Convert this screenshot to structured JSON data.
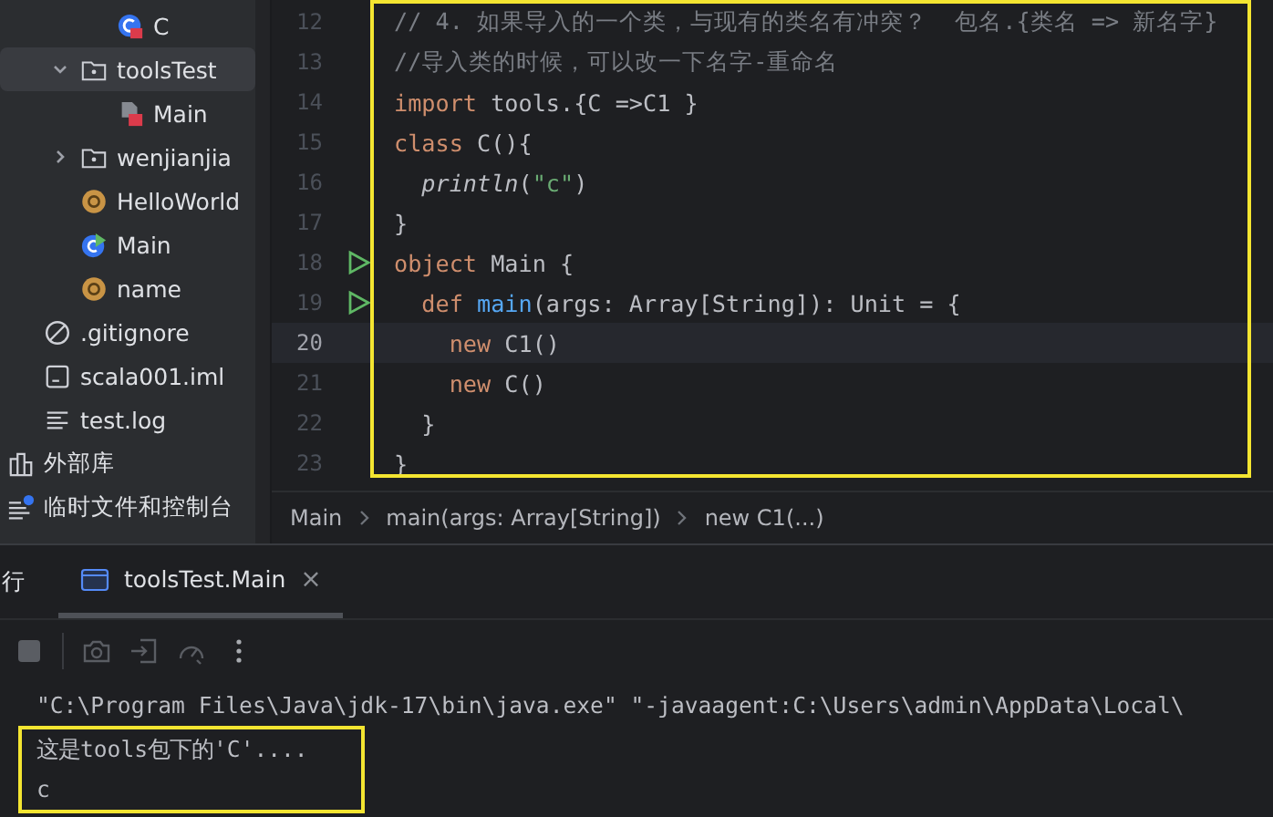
{
  "project_tree": [
    {
      "children": [
        {
          "children": [
            {
              "children": [
                {
                  "label": "C",
                  "kind": "class",
                  "selected": false
                }
              ]
            },
            {
              "label": "toolsTest",
              "kind": "package",
              "expanded": true,
              "selected": true,
              "children": [
                {
                  "label": "Main",
                  "kind": "file",
                  "selected": false
                }
              ]
            },
            {
              "label": "wenjianjia",
              "kind": "package",
              "expanded": false,
              "selected": false
            },
            {
              "label": "HelloWorld",
              "kind": "object",
              "selected": false
            },
            {
              "label": "Main",
              "kind": "runnable",
              "selected": false
            },
            {
              "label": "name",
              "kind": "object",
              "selected": false
            }
          ]
        },
        {
          "label": ".gitignore",
          "kind": "ignore",
          "selected": false
        },
        {
          "label": "scala001.iml",
          "kind": "module",
          "selected": false
        },
        {
          "label": "test.log",
          "kind": "text",
          "selected": false
        }
      ]
    },
    {
      "label": "外部库",
      "kind": "library",
      "selected": false
    },
    {
      "label": "临时文件和控制台",
      "kind": "scratches",
      "selected": false
    }
  ],
  "editor": {
    "highlighted": true,
    "lines": [
      {
        "number": "12",
        "run": false,
        "current": false,
        "tokens": [
          {
            "kind": "comment",
            "text": "// 4. 如果导入的一个类，与现有的类名有冲突？  包名.{类名 => 新名字}"
          }
        ]
      },
      {
        "number": "13",
        "run": false,
        "current": false,
        "tokens": [
          {
            "kind": "comment",
            "text": "//导入类的时候，可以改一下名字-重命名"
          }
        ]
      },
      {
        "number": "14",
        "run": false,
        "current": false,
        "tokens": [
          {
            "kind": "keyword",
            "text": "import"
          },
          {
            "kind": "plain",
            "text": " tools.{C =>C1 }"
          }
        ]
      },
      {
        "number": "15",
        "run": false,
        "current": false,
        "tokens": [
          {
            "kind": "keyword",
            "text": "class"
          },
          {
            "kind": "plain",
            "text": " C(){"
          }
        ]
      },
      {
        "number": "16",
        "run": false,
        "current": false,
        "tokens": [
          {
            "kind": "italic",
            "text": "  println"
          },
          {
            "kind": "plain",
            "text": "("
          },
          {
            "kind": "string",
            "text": "\"c\""
          },
          {
            "kind": "plain",
            "text": ")"
          }
        ]
      },
      {
        "number": "17",
        "run": false,
        "current": false,
        "tokens": [
          {
            "kind": "plain",
            "text": "}"
          }
        ]
      },
      {
        "number": "18",
        "run": true,
        "current": false,
        "tokens": [
          {
            "kind": "keyword",
            "text": "object"
          },
          {
            "kind": "plain",
            "text": " Main {"
          }
        ]
      },
      {
        "number": "19",
        "run": true,
        "current": false,
        "tokens": [
          {
            "kind": "keyword",
            "text": "  def"
          },
          {
            "kind": "function",
            "text": " main"
          },
          {
            "kind": "plain",
            "text": "(args: Array[String]): Unit = {"
          }
        ]
      },
      {
        "number": "20",
        "run": false,
        "current": true,
        "tokens": [
          {
            "kind": "keyword",
            "text": "    new"
          },
          {
            "kind": "plain",
            "text": " C1()"
          }
        ]
      },
      {
        "number": "21",
        "run": false,
        "current": false,
        "tokens": [
          {
            "kind": "keyword",
            "text": "    new"
          },
          {
            "kind": "plain",
            "text": " C()"
          }
        ]
      },
      {
        "number": "22",
        "run": false,
        "current": false,
        "tokens": [
          {
            "kind": "plain",
            "text": "  }"
          }
        ]
      },
      {
        "number": "23",
        "run": false,
        "current": false,
        "tokens": [
          {
            "kind": "plain",
            "text": "}"
          }
        ]
      }
    ]
  },
  "breadcrumbs": [
    "Main",
    "main(args: Array[String])",
    "new C1(...)"
  ],
  "run_panel": {
    "title": "行",
    "tabs": [
      {
        "label": "toolsTest.Main",
        "selected": true
      }
    ],
    "close_symbol": "×"
  },
  "console": {
    "command": "\"C:\\Program Files\\Java\\jdk-17\\bin\\java.exe\" \"-javaagent:C:\\Users\\admin\\AppData\\Local\\",
    "output": {
      "highlighted": true,
      "lines": [
        "这是tools包下的'C'....",
        "c"
      ]
    }
  }
}
